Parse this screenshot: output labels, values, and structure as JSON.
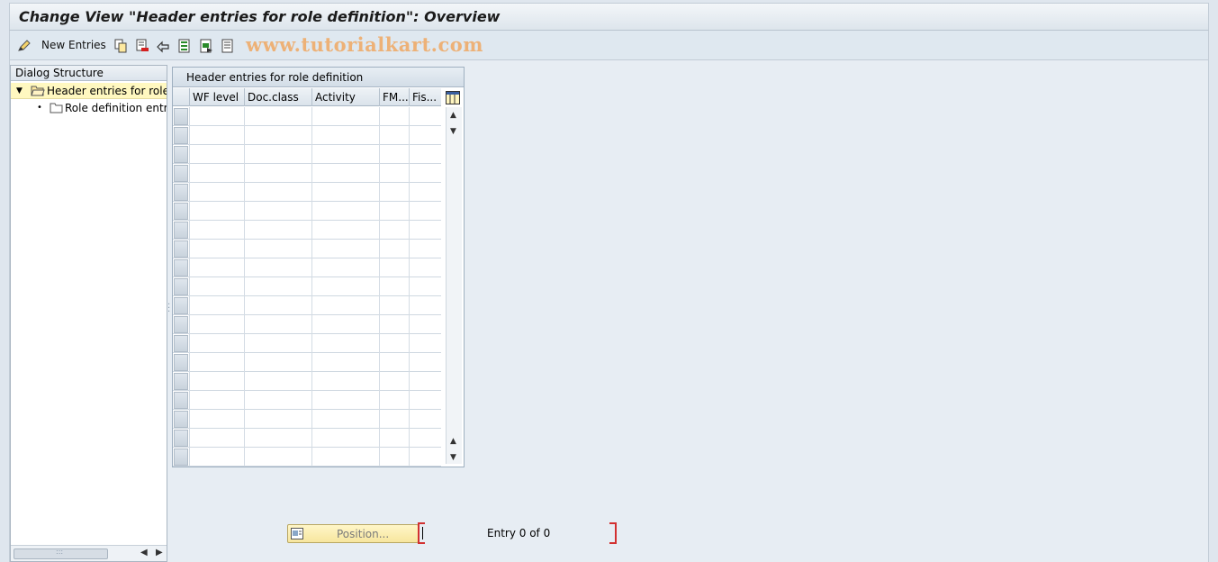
{
  "window": {
    "title": "Change View \"Header entries for role definition\": Overview"
  },
  "toolbar": {
    "new_entries_label": "New Entries",
    "watermark": "www.tutorialkart.com",
    "icons": [
      "pen-icon",
      "copy-icon",
      "delete-icon",
      "undo-icon",
      "select-all-icon",
      "select-block-icon",
      "deselect-all-icon"
    ]
  },
  "dialog_structure": {
    "header": "Dialog Structure",
    "items": [
      {
        "label": "Header entries for role d",
        "level": 0,
        "expanded": true,
        "selected": true
      },
      {
        "label": "Role definition entrie",
        "level": 1,
        "expanded": false,
        "selected": false
      }
    ]
  },
  "table": {
    "title": "Header entries for role definition",
    "columns": [
      "WF level",
      "Doc.class",
      "Activity",
      "FM...",
      "Fis..."
    ],
    "row_count": 19
  },
  "footer": {
    "position_button": "Position...",
    "entry_text": "Entry 0 of 0"
  },
  "colors": {
    "selected_row": "#fff8c0",
    "position_button": "#f7e69e",
    "required_bracket": "#d23030",
    "watermark": "#f0a862"
  }
}
